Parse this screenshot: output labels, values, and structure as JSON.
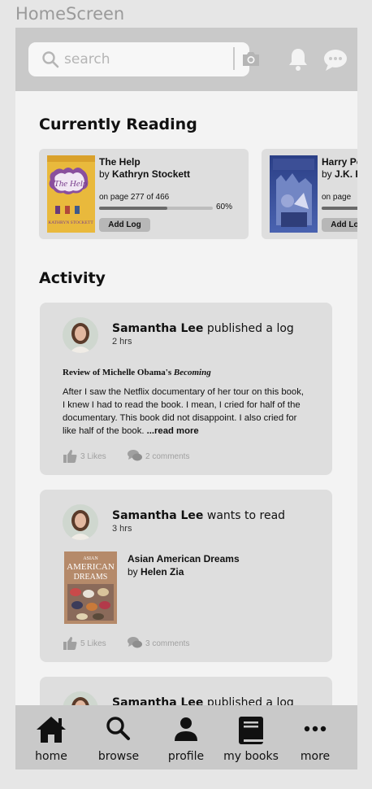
{
  "frame_title": "HomeScreen",
  "search": {
    "placeholder": "search"
  },
  "currently_reading": {
    "title": "Currently Reading",
    "books": [
      {
        "title": "The Help",
        "by": "by",
        "author": "Kathryn Stockett",
        "page_text": "on page 277 of 466",
        "progress": 0.6,
        "progress_label": "60%",
        "button": "Add Log",
        "cover_title": "The Help",
        "cover_author": "KATHRYN STOCKETT"
      },
      {
        "title": "Harry Potter",
        "by": "by",
        "author": "J.K. Rowling",
        "page_text": "on page",
        "button": "Add Log"
      }
    ]
  },
  "activity": {
    "title": "Activity",
    "posts": [
      {
        "user": "Samantha Lee",
        "action": "published a log",
        "time": "2 hrs",
        "review_prefix": "Review of Michelle Obama's",
        "review_book": "Becoming",
        "body": "After I saw the Netflix documentary of her tour on this book, I knew I had to read the book. I mean, I cried for half of the documentary. This book did not disappoint. I also cried for like half of the book. ",
        "read_more": "...read more",
        "likes": "3 Likes",
        "comments": "2 comments"
      },
      {
        "user": "Samantha Lee",
        "action": "wants to read",
        "time": "3 hrs",
        "book_title": "Asian American Dreams",
        "by": "by",
        "book_author": "Helen Zia",
        "cover_line1": "ASIAN",
        "cover_line2": "AMERICAN",
        "cover_line3": "DREAMS",
        "likes": "5 Likes",
        "comments": "3 comments"
      },
      {
        "user": "Samantha Lee",
        "action": "published a log"
      }
    ]
  },
  "nav": [
    {
      "label": "home",
      "icon": "home-icon"
    },
    {
      "label": "browse",
      "icon": "search-icon"
    },
    {
      "label": "profile",
      "icon": "person-icon"
    },
    {
      "label": "my books",
      "icon": "book-icon"
    },
    {
      "label": "more",
      "icon": "more-icon"
    }
  ]
}
